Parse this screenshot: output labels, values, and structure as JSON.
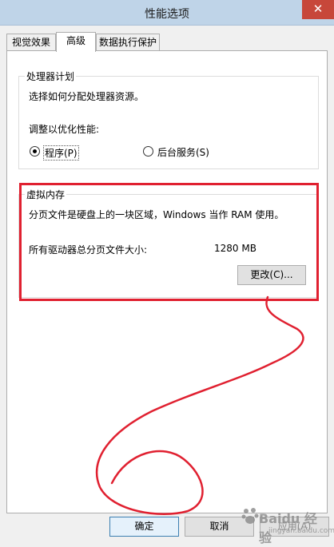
{
  "window": {
    "title": "性能选项",
    "close_glyph": "✕"
  },
  "tabs": [
    {
      "label": "视觉效果"
    },
    {
      "label": "高级"
    },
    {
      "label": "数据执行保护"
    }
  ],
  "processor": {
    "group_title": "处理器计划",
    "description": "选择如何分配处理器资源。",
    "adjust_label": "调整以优化性能:",
    "options": [
      {
        "label": "程序(P)",
        "selected": true
      },
      {
        "label": "后台服务(S)",
        "selected": false
      }
    ]
  },
  "virtual_memory": {
    "group_title": "虚拟内存",
    "description": "分页文件是硬盘上的一块区域，Windows 当作 RAM 使用。",
    "total_label": "所有驱动器总分页文件大小:",
    "total_value": "1280 MB",
    "change_button": "更改(C)..."
  },
  "buttons": {
    "ok": "确定",
    "cancel": "取消",
    "apply": "应用(A)"
  },
  "watermark": {
    "text": "Baidu 经验",
    "url": "jingyan.baidu.com"
  },
  "colors": {
    "annotation_red": "#e02030",
    "titlebar": "#bfd4e8",
    "close": "#c7473a"
  }
}
